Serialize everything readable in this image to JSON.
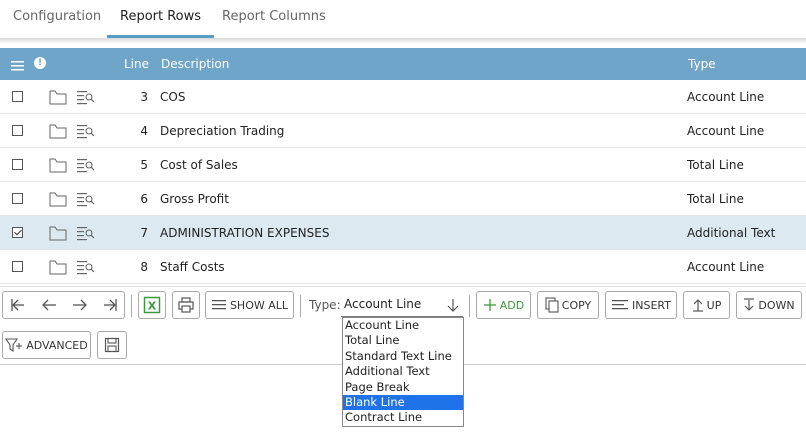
{
  "tabs": [
    {
      "label": "Configuration"
    },
    {
      "label": "Report Rows"
    },
    {
      "label": "Report Columns"
    }
  ],
  "grid": {
    "badge": "!",
    "headers": {
      "line": "Line",
      "description": "Description",
      "type": "Type"
    },
    "rows": [
      {
        "line": "3",
        "description": "COS",
        "type": "Account Line",
        "checked": false
      },
      {
        "line": "4",
        "description": "Depreciation Trading",
        "type": "Account Line",
        "checked": false
      },
      {
        "line": "5",
        "description": "Cost of Sales",
        "type": "Total Line",
        "checked": false
      },
      {
        "line": "6",
        "description": "Gross Profit",
        "type": "Total Line",
        "checked": false
      },
      {
        "line": "7",
        "description": "ADMINISTRATION EXPENSES",
        "type": "Additional Text",
        "checked": true
      },
      {
        "line": "8",
        "description": "Staff Costs",
        "type": "Account Line",
        "checked": false
      }
    ]
  },
  "toolbar": {
    "show_all": "SHOW ALL",
    "type_label": "Type:",
    "type_value": "Account Line",
    "add": "ADD",
    "copy": "COPY",
    "insert": "INSERT",
    "up": "UP",
    "down": "DOWN",
    "advanced": "ADVANCED",
    "excel_color": "#3a9a3a",
    "add_color": "#3a9a3a"
  },
  "dropdown": {
    "options": [
      "Account Line",
      "Total Line",
      "Standard Text Line",
      "Additional Text",
      "Page Break",
      "Blank Line",
      "Contract Line"
    ],
    "highlighted": "Blank Line"
  },
  "colors": {
    "header_bg": "#6fa5c8",
    "selected_row_bg": "#dce9f1",
    "active_tab_underline": "#5a9dc4",
    "highlight": "#1e73e8"
  }
}
